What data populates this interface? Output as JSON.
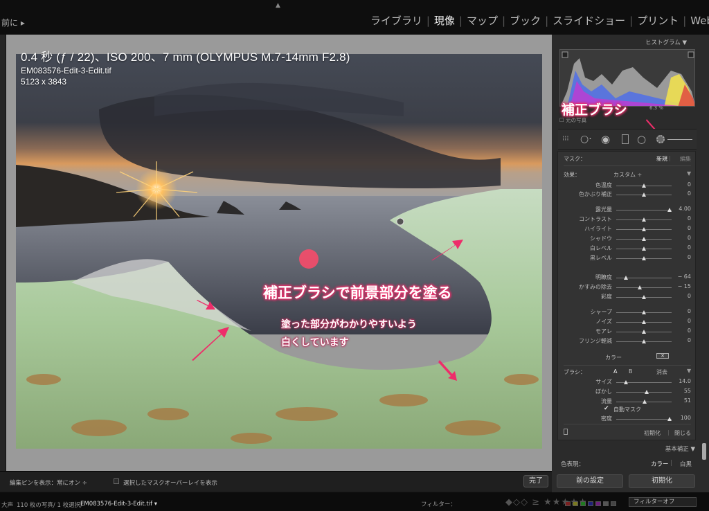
{
  "topbar": {
    "back_label": "前に ▸",
    "modules": [
      {
        "label": "ライブラリ",
        "active": false
      },
      {
        "label": "現像",
        "active": true
      },
      {
        "label": "マップ",
        "active": false
      },
      {
        "label": "ブック",
        "active": false
      },
      {
        "label": "スライドショー",
        "active": false
      },
      {
        "label": "プリント",
        "active": false
      },
      {
        "label": "Web",
        "active": false
      }
    ]
  },
  "photo_info": {
    "exposure": "0.4 秒 (ƒ / 22)、ISO 200、7 mm (OLYMPUS M.7-14mm F2.8)",
    "filename": "EM083576-Edit-3-Edit.tif",
    "dimensions": "5123 x 3843"
  },
  "annotations": {
    "main": "補正ブラシで前景部分を塗る",
    "sub_line1": "塗った部分がわかりやすいよう",
    "sub_line2": "白くしています",
    "brush": "補正ブラシ"
  },
  "toolbar": {
    "pin_label": "編集ピンを表示：常にオン ÷",
    "overlay_label": "選択したマスクオーバーレイを表示",
    "done_label": "完了"
  },
  "status": {
    "left": "大声",
    "count": "110 枚の写真/ 1 枚選択/",
    "file": "EM083576-Edit-3-Edit.tif ▾",
    "filter_label": "フィルター：",
    "filter_off": "フィルターオフ"
  },
  "right_panel": {
    "histogram_title": "ヒストグラム ▼",
    "histogram_pct": "6.3 %",
    "original_photo": "元の写真",
    "mask_label": "マスク：",
    "mask_new": "新規",
    "mask_edit": "編集",
    "effect_label": "効果：",
    "effect_value": "カスタム ÷",
    "sliders": [
      {
        "label": "色温度",
        "value": "0",
        "pos": 0.5
      },
      {
        "label": "色かぶり補正",
        "value": "0",
        "pos": 0.5
      },
      {
        "label": "露光量",
        "value": "4.00",
        "pos": 0.96
      },
      {
        "label": "コントラスト",
        "value": "0",
        "pos": 0.5
      },
      {
        "label": "ハイライト",
        "value": "0",
        "pos": 0.5
      },
      {
        "label": "シャドウ",
        "value": "0",
        "pos": 0.5
      },
      {
        "label": "白レベル",
        "value": "0",
        "pos": 0.5
      },
      {
        "label": "黒レベル",
        "value": "0",
        "pos": 0.5
      },
      {
        "label": "明瞭度",
        "value": "− 64",
        "pos": 0.18
      },
      {
        "label": "かすみの除去",
        "value": "− 15",
        "pos": 0.42
      },
      {
        "label": "彩度",
        "value": "0",
        "pos": 0.5
      },
      {
        "label": "シャープ",
        "value": "0",
        "pos": 0.5
      },
      {
        "label": "ノイズ",
        "value": "0",
        "pos": 0.5
      },
      {
        "label": "モアレ",
        "value": "0",
        "pos": 0.5
      },
      {
        "label": "フリンジ軽減",
        "value": "0",
        "pos": 0.5
      }
    ],
    "color_label": "カラー",
    "brush_label": "ブラシ：",
    "brush_a": "A",
    "brush_b": "B",
    "brush_erase": "消去",
    "brush_sliders": [
      {
        "label": "サイズ",
        "value": "14.0",
        "pos": 0.17
      },
      {
        "label": "ぼかし",
        "value": "55",
        "pos": 0.55
      },
      {
        "label": "流量",
        "value": "51",
        "pos": 0.51
      },
      {
        "label": "密度",
        "value": "100",
        "pos": 0.96
      }
    ],
    "auto_mask": "自動マスク",
    "reset": "初期化",
    "close": "閉じる",
    "basic_title": "基本補正 ▼",
    "treatment_label": "色表現：",
    "treatment_color": "カラー",
    "treatment_bw": "白黒",
    "prev_button": "前の設定",
    "reset_button": "初期化"
  }
}
